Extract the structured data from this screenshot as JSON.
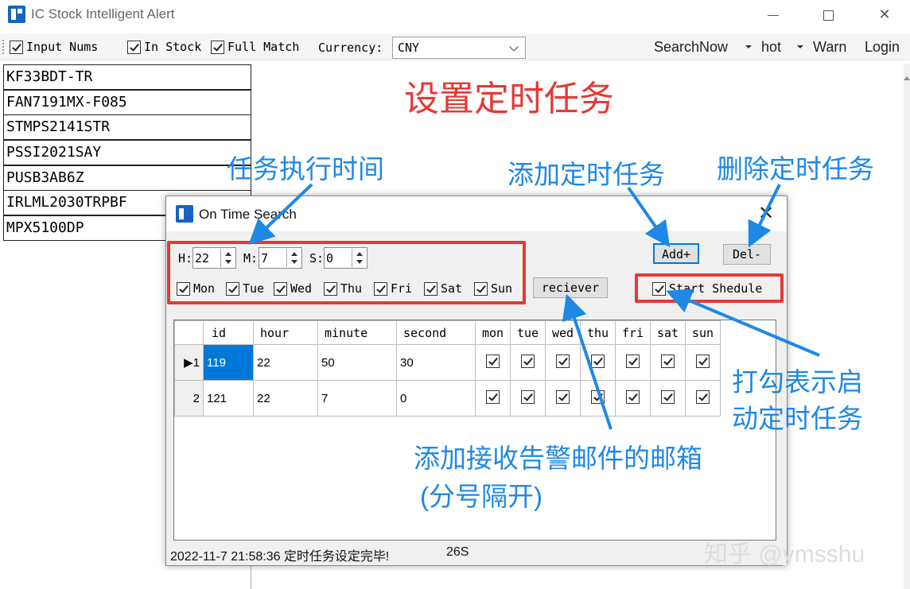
{
  "window": {
    "title": "IC Stock Intelligent Alert"
  },
  "toolbar": {
    "input_nums": "Input Nums",
    "in_stock": "In Stock",
    "full_match": "Full Match",
    "currency_label": "Currency:",
    "currency_value": "CNY",
    "search_now": "SearchNow",
    "hot": "hot",
    "warn": "Warn",
    "login": "Login"
  },
  "parts": [
    "KF33BDT-TR",
    "FAN7191MX-F085",
    "STMPS2141STR",
    "PSSI2021SAY",
    "PUSB3AB6Z",
    "IRLML2030TRPBF",
    "MPX5100DP"
  ],
  "dialog": {
    "title": "On Time Search",
    "h_label": "H:",
    "h_value": "22",
    "m_label": "M:",
    "m_value": "7",
    "s_label": "S:",
    "s_value": "0",
    "days": [
      "Mon",
      "Tue",
      "Wed",
      "Thu",
      "Fri",
      "Sat",
      "Sun"
    ],
    "add_label": "Add+",
    "del_label": "Del-",
    "reciever_label": "reciever",
    "start_label": "Start Shedule",
    "columns": [
      "id",
      "hour",
      "minute",
      "second",
      "mon",
      "tue",
      "wed",
      "thu",
      "fri",
      "sat",
      "sun"
    ],
    "rows": [
      {
        "marker": "▶1",
        "id": "119",
        "hour": "22",
        "minute": "50",
        "second": "30"
      },
      {
        "marker": "2",
        "id": "121",
        "hour": "22",
        "minute": "7",
        "second": "0"
      }
    ],
    "status": "2022-11-7 21:58:36 定时任务设定完毕!",
    "status_count": "26S"
  },
  "annotations": {
    "heading": "设置定时任务",
    "exec_time": "任务执行时间",
    "add_task": "添加定时任务",
    "del_task": "删除定时任务",
    "check_start_1": "打勾表示启",
    "check_start_2": "动定时任务",
    "receiver_1": "添加接收告警邮件的邮箱",
    "receiver_2": "(分号隔开)"
  },
  "watermark": "知乎 @ymsshu",
  "colors": {
    "annotation_red": "#e53935",
    "annotation_blue": "#1e88e5",
    "selection": "#0078d7"
  }
}
